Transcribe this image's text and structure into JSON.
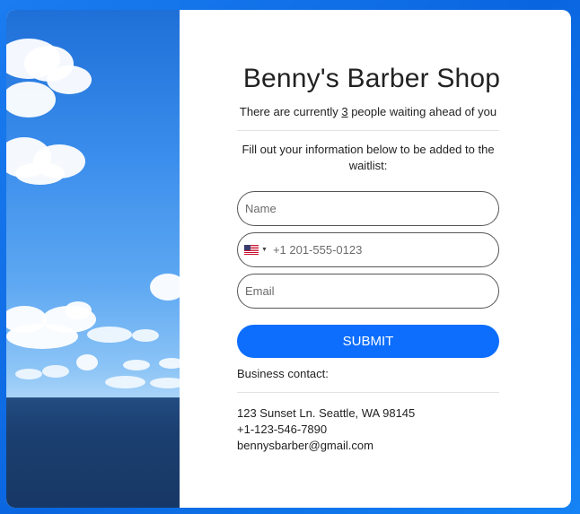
{
  "shop": {
    "name": "Benny's Barber Shop",
    "waiting_prefix": "There are currently ",
    "waiting_count": "3",
    "waiting_suffix": " people waiting ahead of you"
  },
  "form": {
    "instructions": "Fill out your information below to be added to the waitlist:",
    "name_placeholder": "Name",
    "phone_placeholder": "+1 201-555-0123",
    "phone_country": "us-flag-icon",
    "email_placeholder": "Email",
    "submit_label": "SUBMIT"
  },
  "contact": {
    "label": "Business contact:",
    "address": "123 Sunset Ln. Seattle, WA 98145",
    "phone": "+1-123-546-7890",
    "email": "bennysbarber@gmail.com"
  },
  "colors": {
    "accent": "#0d6efd",
    "background": "#0a66e0"
  }
}
